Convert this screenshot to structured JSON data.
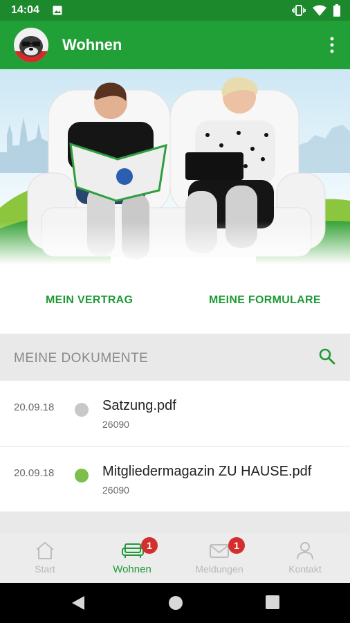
{
  "status_bar": {
    "time": "14:04"
  },
  "app_bar": {
    "title": "Wohnen"
  },
  "actions": {
    "contract": "MEIN VERTRAG",
    "forms": "MEINE FORMULARE"
  },
  "documents": {
    "header": "MEINE DOKUMENTE",
    "items": [
      {
        "date": "20.09.18",
        "name": "Satzung.pdf",
        "size": "26090",
        "status_color": "#c8c8c8"
      },
      {
        "date": "20.09.18",
        "name": "Mitgliedermagazin ZU HAUSE.pdf",
        "size": "26090",
        "status_color": "#7cc04b"
      }
    ]
  },
  "bottom_nav": {
    "items": [
      {
        "label": "Start",
        "icon": "home-icon"
      },
      {
        "label": "Wohnen",
        "icon": "sofa-icon",
        "badge": "1",
        "active": true
      },
      {
        "label": "Meldungen",
        "icon": "mail-icon",
        "badge": "1"
      },
      {
        "label": "Kontakt",
        "icon": "person-icon"
      }
    ]
  },
  "colors": {
    "primary": "#21a038",
    "statusbar": "#1c8a2c",
    "badge": "#d32f2f"
  }
}
